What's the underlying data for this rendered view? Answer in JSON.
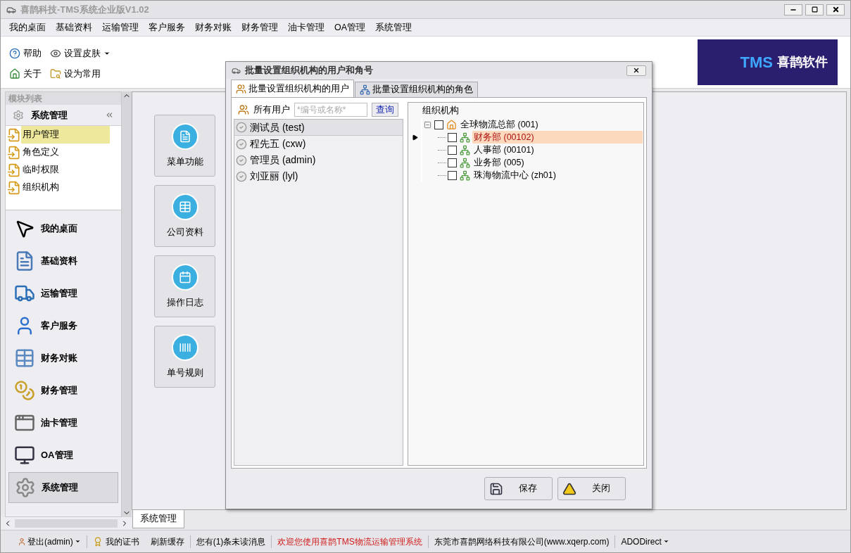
{
  "window": {
    "title": "喜鹊科技-TMS系统企业版V1.02"
  },
  "menu": [
    "我的桌面",
    "基础资料",
    "运输管理",
    "客户服务",
    "财务对账",
    "财务管理",
    "油卡管理",
    "OA管理",
    "系统管理"
  ],
  "toolbar": [
    [
      {
        "label": "帮助",
        "kind": "help",
        "dropdown": false
      },
      {
        "label": "设置皮肤",
        "kind": "skin",
        "dropdown": true
      }
    ],
    [
      {
        "label": "关于",
        "kind": "home",
        "dropdown": false
      },
      {
        "label": "设为常用",
        "kind": "favorite",
        "dropdown": false
      }
    ]
  ],
  "banner": {
    "logo": "TMS",
    "name": "喜鹊软件"
  },
  "sidebar": {
    "title": "模块列表",
    "group": "系统管理",
    "items": [
      {
        "label": "用户管理",
        "selected": true
      },
      {
        "label": "角色定义",
        "selected": false
      },
      {
        "label": "临时权限",
        "selected": false
      },
      {
        "label": "组织机构",
        "selected": false
      }
    ],
    "modules": [
      {
        "label": "我的桌面",
        "kind": "desktop",
        "selected": false
      },
      {
        "label": "基础资料",
        "kind": "basic",
        "selected": false
      },
      {
        "label": "运输管理",
        "kind": "transport",
        "selected": false
      },
      {
        "label": "客户服务",
        "kind": "customer",
        "selected": false
      },
      {
        "label": "财务对账",
        "kind": "reconcile",
        "selected": false
      },
      {
        "label": "财务管理",
        "kind": "finance",
        "selected": false
      },
      {
        "label": "油卡管理",
        "kind": "card",
        "selected": false
      },
      {
        "label": "OA管理",
        "kind": "oa",
        "selected": false
      },
      {
        "label": "系统管理",
        "kind": "system",
        "selected": true
      }
    ]
  },
  "tiles": [
    {
      "label": "菜单功能",
      "kind": "menu"
    },
    {
      "label": "公司资料",
      "kind": "company"
    },
    {
      "label": "操作日志",
      "kind": "log"
    },
    {
      "label": "单号规则",
      "kind": "number"
    }
  ],
  "doc_tabs": [
    {
      "label": "系统管理",
      "selected": true
    }
  ],
  "dialog": {
    "title": "批量设置组织机构的用户和角号",
    "tabs": [
      {
        "label": "批量设置组织机构的用户",
        "kind": "users",
        "selected": true
      },
      {
        "label": "批量设置组织机构的角色",
        "kind": "roles",
        "selected": false
      }
    ],
    "users_label": "所有用户",
    "search": {
      "placeholder": "*编号或名称*"
    },
    "search_button": "查询",
    "users": [
      {
        "label": "测试员 (test)",
        "selected": true
      },
      {
        "label": "程先五 (cxw)",
        "selected": false
      },
      {
        "label": "管理员 (admin)",
        "selected": false
      },
      {
        "label": "刘亚丽 (lyl)",
        "selected": false
      }
    ],
    "tree": {
      "header": "组织机构",
      "nodes": [
        {
          "label": "全球物流总部 (001)",
          "kind": "root",
          "checked": false,
          "expanded": true,
          "selected": false,
          "children": [
            {
              "label": "财务部 (00102)",
              "kind": "dept",
              "checked": false,
              "selected": true
            },
            {
              "label": "人事部 (00101)",
              "kind": "dept",
              "checked": false,
              "selected": false
            },
            {
              "label": "业务部 (005)",
              "kind": "dept",
              "checked": false,
              "selected": false
            },
            {
              "label": "珠海物流中心 (zh01)",
              "kind": "dept",
              "checked": false,
              "selected": false
            }
          ]
        }
      ]
    },
    "buttons": [
      {
        "label": "保存",
        "kind": "save"
      },
      {
        "label": "关闭",
        "kind": "exit"
      }
    ]
  },
  "status_bar": [
    {
      "text": "登出(admin)",
      "kind": "user"
    },
    {
      "text": "我的证书",
      "kind": "cert"
    },
    {
      "text": "刷新缓存",
      "kind": "plain"
    },
    {
      "text": "您有(1)条未读消息",
      "kind": "plain"
    },
    {
      "text": "欢迎您使用喜鹊TMS物流运输管理系统",
      "kind": "notice"
    },
    {
      "text": "东莞市喜鹊网络科技有限公司(www.xqerp.com)",
      "kind": "plain"
    },
    {
      "text": "ADODirect",
      "kind": "dropdown"
    }
  ]
}
